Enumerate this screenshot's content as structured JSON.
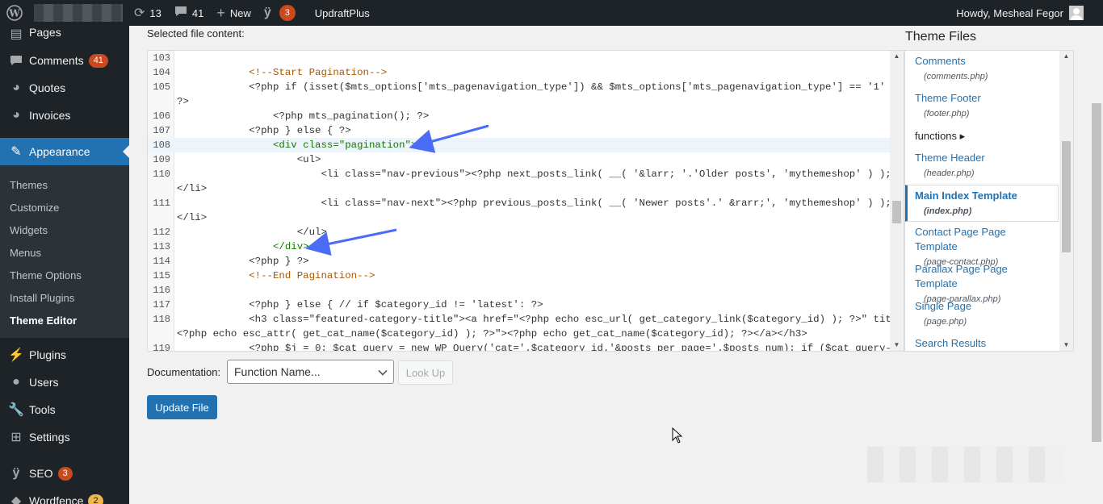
{
  "adminbar": {
    "updates_count": "13",
    "comments_count": "41",
    "new_label": "New",
    "yoast_count": "3",
    "plugin_label": "UpdraftPlus",
    "howdy": "Howdy, Mesheal Fegor"
  },
  "sidebar": {
    "items": [
      {
        "label": "Pages",
        "icon": "pages-icon"
      },
      {
        "label": "Comments",
        "icon": "comments-icon",
        "count": "41"
      },
      {
        "label": "Quotes",
        "icon": "quotes-icon"
      },
      {
        "label": "Invoices",
        "icon": "invoices-icon"
      },
      {
        "label": "Appearance",
        "icon": "appearance-icon"
      },
      {
        "label": "Plugins",
        "icon": "plugins-icon"
      },
      {
        "label": "Users",
        "icon": "users-icon"
      },
      {
        "label": "Tools",
        "icon": "tools-icon"
      },
      {
        "label": "Settings",
        "icon": "settings-icon"
      },
      {
        "label": "SEO",
        "icon": "seo-icon",
        "count": "3"
      },
      {
        "label": "Wordfence",
        "icon": "wordfence-icon",
        "count": "2"
      }
    ],
    "appearance_sub": [
      "Themes",
      "Customize",
      "Widgets",
      "Menus",
      "Theme Options",
      "Install Plugins",
      "Theme Editor"
    ]
  },
  "editor": {
    "label": "Selected file content:",
    "lines": [
      {
        "n": "103",
        "t": ""
      },
      {
        "n": "104",
        "t": "            <!--Start Pagination-->"
      },
      {
        "n": "105",
        "t": "            <?php if (isset($mts_options['mts_pagenavigation_type']) && $mts_options['mts_pagenavigation_type'] == '1' ) {"
      },
      {
        "n": "",
        "t": "?>"
      },
      {
        "n": "106",
        "t": "                <?php mts_pagination(); ?>"
      },
      {
        "n": "107",
        "t": "            <?php } else { ?>"
      },
      {
        "n": "108",
        "t": "                <div class=\"pagination\">"
      },
      {
        "n": "109",
        "t": "                    <ul>"
      },
      {
        "n": "110",
        "t": "                        <li class=\"nav-previous\"><?php next_posts_link( __( '&larr; '.'Older posts', 'mythemeshop' ) ); ?>"
      },
      {
        "n": "",
        "t": "</li>"
      },
      {
        "n": "111",
        "t": "                        <li class=\"nav-next\"><?php previous_posts_link( __( 'Newer posts'.' &rarr;', 'mythemeshop' ) ); ?>"
      },
      {
        "n": "",
        "t": "</li>"
      },
      {
        "n": "112",
        "t": "                    </ul>"
      },
      {
        "n": "113",
        "t": "                </div>"
      },
      {
        "n": "114",
        "t": "            <?php } ?>"
      },
      {
        "n": "115",
        "t": "            <!--End Pagination-->"
      },
      {
        "n": "116",
        "t": ""
      },
      {
        "n": "117",
        "t": "            <?php } else { // if $category_id != 'latest': ?>"
      },
      {
        "n": "118",
        "t": "            <h3 class=\"featured-category-title\"><a href=\"<?php echo esc_url( get_category_link($category_id) ); ?>\" title=\""
      },
      {
        "n": "",
        "t": "<?php echo esc_attr( get_cat_name($category_id) ); ?>\"><?php echo get_cat_name($category_id); ?></a></h3>"
      },
      {
        "n": "119",
        "t": "            <?php $j = 0; $cat_query = new WP_Query('cat='.$category_id.'&posts_per_page='.$posts_num); if ($cat_query-"
      }
    ]
  },
  "theme_files": {
    "title": "Theme Files",
    "items": [
      {
        "name": "Comments",
        "file": "(comments.php)"
      },
      {
        "name": "Theme Footer",
        "file": "(footer.php)"
      },
      {
        "name": "functions ▸",
        "file": ""
      },
      {
        "name": "Theme Header",
        "file": "(header.php)"
      },
      {
        "name": "Main Index Template",
        "file": "(index.php)"
      },
      {
        "name": "Contact Page Page Template",
        "file": "(page-contact.php)"
      },
      {
        "name": "Parallax Page Page Template",
        "file": "(page-parallax.php)"
      },
      {
        "name": "Single Page",
        "file": "(page.php)"
      },
      {
        "name": "Search Results",
        "file": "(search.php)"
      }
    ]
  },
  "documentation": {
    "label": "Documentation:",
    "select_value": "Function Name...",
    "lookup_label": "Look Up"
  },
  "update_label": "Update File",
  "colors": {
    "accent": "#2271b1",
    "adminbar": "#1d2327",
    "badge": "#d63638",
    "arrow": "#4a6cf7"
  }
}
